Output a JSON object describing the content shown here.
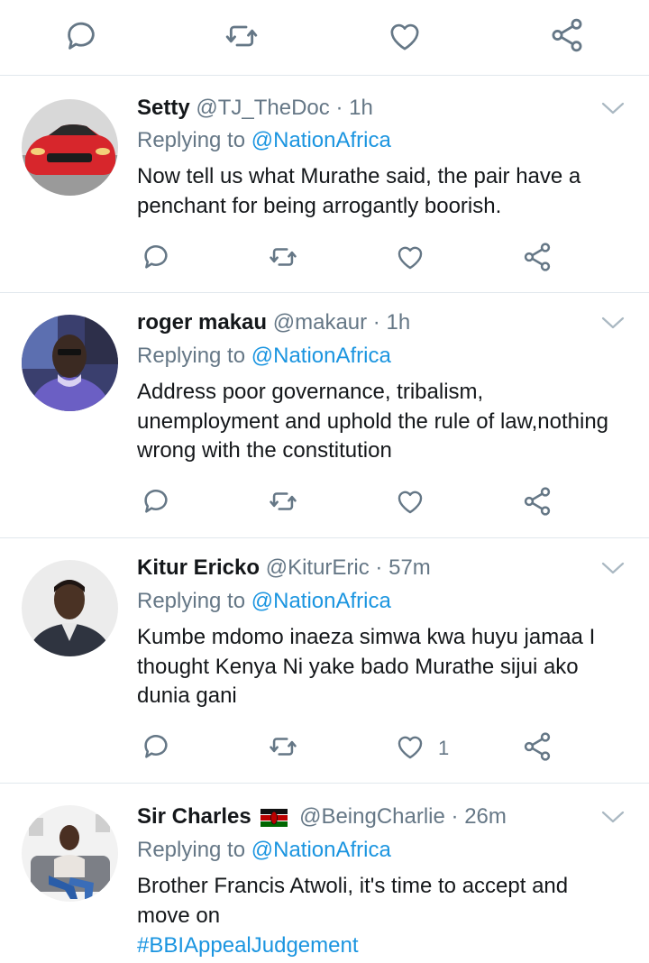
{
  "top_actions": {
    "icons": [
      "reply-icon",
      "retweet-icon",
      "like-icon",
      "share-icon"
    ]
  },
  "tweets": [
    {
      "name": "Setty",
      "handle": "@TJ_TheDoc",
      "separator": "·",
      "time": "1h",
      "replying_prefix": "Replying to",
      "replying_to": "@NationAfrica",
      "text": "Now tell us what Murathe said, the pair have a penchant for being arrogantly boorish.",
      "like_count": ""
    },
    {
      "name": "roger makau",
      "handle": "@makaur",
      "separator": "·",
      "time": "1h",
      "replying_prefix": "Replying to",
      "replying_to": "@NationAfrica",
      "text": "Address poor governance, tribalism, unemployment and uphold the rule of law,nothing wrong with the constitution",
      "like_count": ""
    },
    {
      "name": "Kitur Ericko",
      "handle": "@KiturEric",
      "separator": "·",
      "time": "57m",
      "replying_prefix": "Replying to",
      "replying_to": "@NationAfrica",
      "text": "Kumbe mdomo inaeza simwa kwa huyu jamaa  I thought Kenya Ni yake bado Murathe sijui ako dunia gani",
      "like_count": "1"
    },
    {
      "name": "Sir Charles",
      "handle": "@BeingCharlie",
      "separator": "·",
      "time": "26m",
      "replying_prefix": "Replying to",
      "replying_to": "@NationAfrica",
      "text": "Brother Francis Atwoli, it's time to accept and move on",
      "hashtag": "#BBIAppealJudgement"
    }
  ],
  "colors": {
    "text": "#14171a",
    "secondary": "#657786",
    "link": "#1b95e0",
    "divider": "#e1e8ed",
    "icon": "#657786"
  }
}
